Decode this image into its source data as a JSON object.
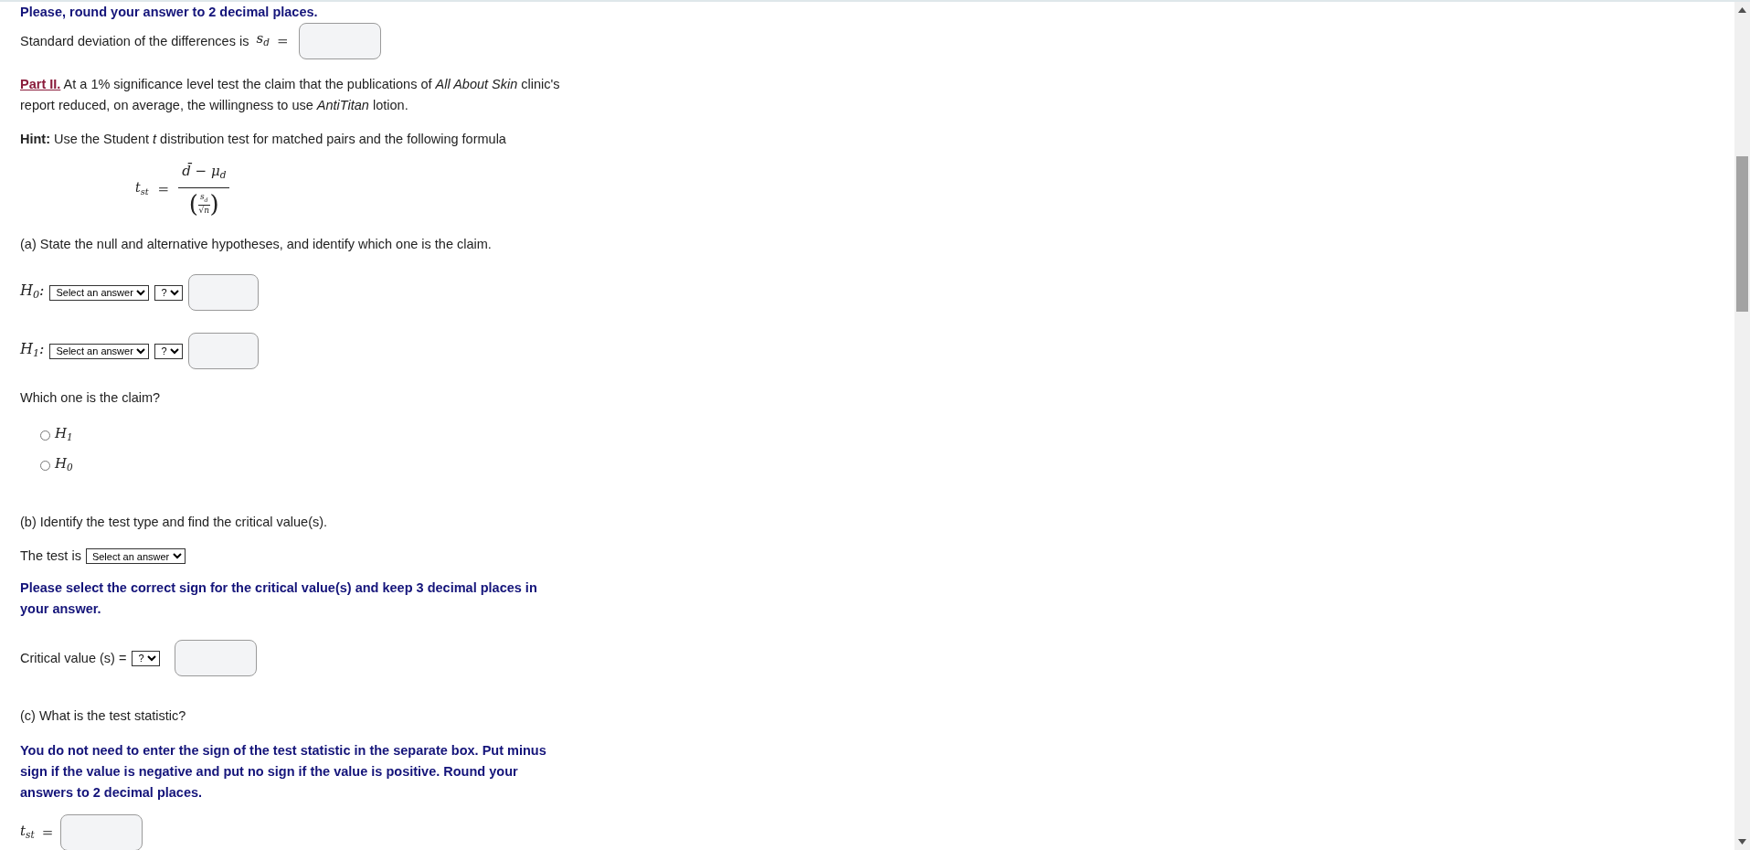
{
  "notice": "Please, round your answer to 2 decimal places.",
  "sd_row": {
    "label": "Standard deviation of the differences is",
    "math": "s$_{d}$",
    "eq": "="
  },
  "part": {
    "link": "Part II.",
    "text": " At a 1% significance level test the claim that the publications of *All About Skin* clinic's report reduced, on average, the willingness to use *AntiTitan* lotion."
  },
  "hint": "**Hint:**  Use the Student *t* distribution test for matched pairs and the following formula",
  "formula": {
    "lhs": "t$_{st}$",
    "eq": "=",
    "numerator": "d̄ − μ$_{d}$",
    "open": "(",
    "close": ")",
    "inner_top": "s$_{d}$",
    "inner_bottom": "√n"
  },
  "part_a": "(a) State the null and alternative hypotheses, and identify which one is the claim.",
  "hypotheses": [
    {
      "label": "H$_{0}$:",
      "select": "Select an answer",
      "sign": "?"
    },
    {
      "label": "H$_{1}$:",
      "select": "Select an answer",
      "sign": "?"
    }
  ],
  "claim_question": "Which one is the claim?",
  "claim_options": [
    {
      "label": "H$_{1}$",
      "selected": false
    },
    {
      "label": "H$_{0}$",
      "selected": false
    }
  ],
  "part_b": "(b) Identify the test type and find the critical value(s).",
  "test_row": {
    "label": "The test is",
    "select": "Select an answer"
  },
  "critical_notice": "Please select the correct sign for the critical value(s) and keep 3 decimal places in your answer.",
  "critical_row": {
    "label": "Critical value (s) =",
    "sign": "?"
  },
  "part_c": "(c) What is the test statistic?",
  "statistic_notice": "You do not need to enter the sign of the test statistic in the separate box. Put minus sign if the value is negative and put no sign if the value is positive. Round your answers to 2 decimal places.",
  "statistic_row": {
    "math": "t$_{st}$",
    "eq": "="
  }
}
